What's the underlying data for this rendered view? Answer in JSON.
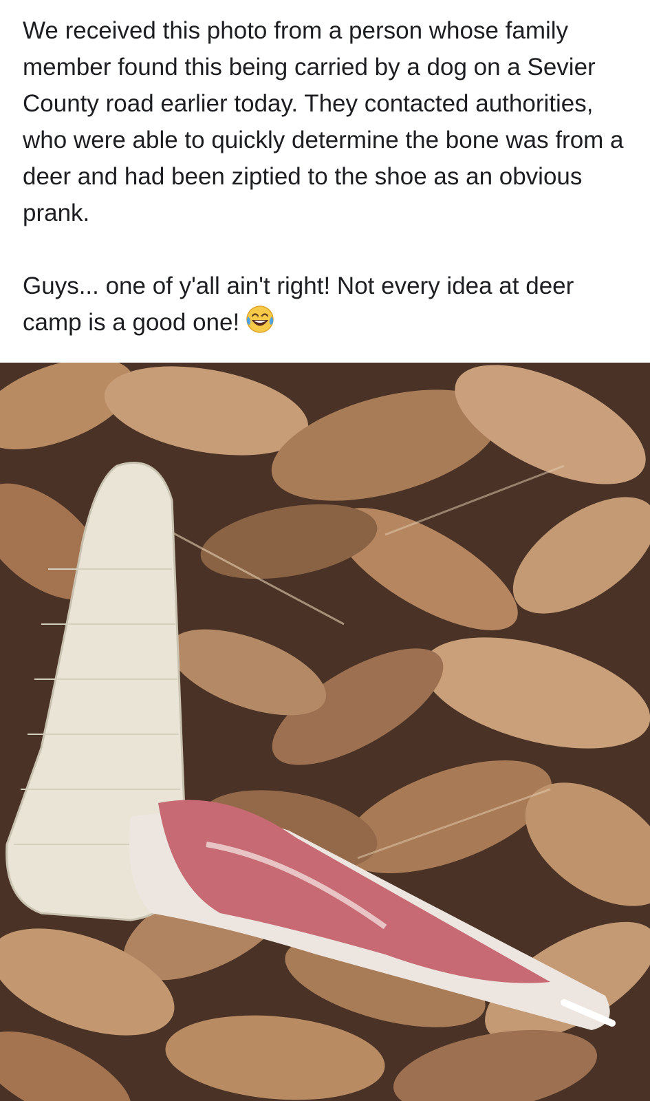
{
  "post": {
    "paragraph_1": "We received this photo from a person whose family member found this being carried by a dog on a Sevier County road earlier today. They contacted authorities, who were able to quickly determine the bone was from a deer and had been ziptied to the shoe as an obvious prank.",
    "paragraph_2": "Guys... one of y'all ain't right! Not every idea at deer camp is a good one!",
    "emoji": "face-with-tears-of-joy-icon"
  },
  "photo": {
    "subject": "white knit shoe ziptied to a deer leg bone lying on dry brown leaves",
    "colors": {
      "leaf_light": "#c9a07a",
      "leaf_mid": "#a87a55",
      "leaf_dark": "#6b4a35",
      "shoe": "#e9e4d6",
      "meat": "#c76a74",
      "bone": "#ede6e0"
    }
  }
}
